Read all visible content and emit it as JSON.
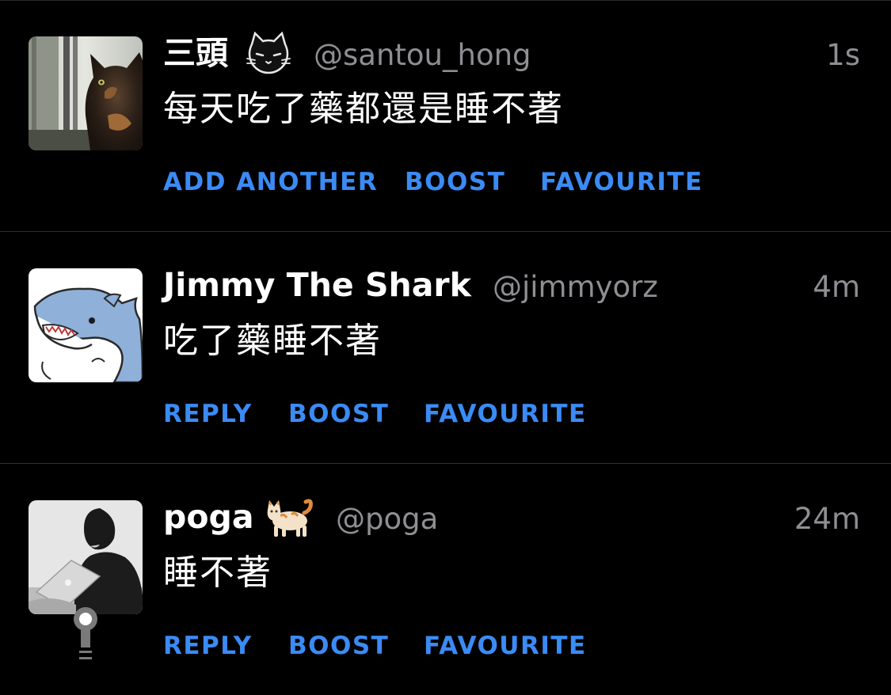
{
  "timeline": {
    "posts": [
      {
        "display_name": "三頭",
        "name_emoji": "cat-face-icon",
        "handle": "@santou_hong",
        "timestamp": "1s",
        "content": "每天吃了藥都還是睡不著",
        "actions": [
          "ADD ANOTHER",
          "BOOST",
          "FAVOURITE"
        ],
        "avatar": "tortoiseshell-cat-photo"
      },
      {
        "display_name": "Jimmy The Shark",
        "handle": "@jimmyorz",
        "timestamp": "4m",
        "content": "吃了藥睡不著",
        "actions": [
          "REPLY",
          "BOOST",
          "FAVOURITE"
        ],
        "avatar": "cartoon-shark-drawing"
      },
      {
        "display_name": "poga",
        "name_emoji": "orange-cat-icon",
        "handle": "@poga",
        "timestamp": "24m",
        "content": "睡不著",
        "actions": [
          "REPLY",
          "BOOST",
          "FAVOURITE"
        ],
        "avatar": "person-with-laptop-photo"
      }
    ]
  },
  "colors": {
    "background": "#000000",
    "action": "#3b8bf5",
    "secondary_text": "#8e8e93",
    "divider": "#2e2e2e"
  }
}
